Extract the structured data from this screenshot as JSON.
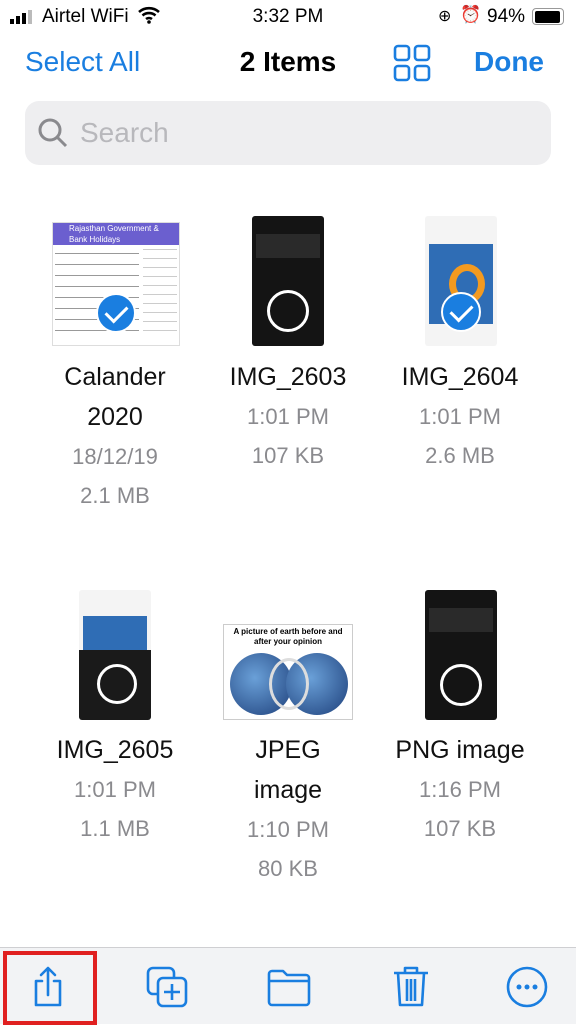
{
  "status": {
    "carrier": "Airtel WiFi",
    "time": "3:32 PM",
    "battery": "94%"
  },
  "nav": {
    "select_all": "Select All",
    "title": "2 Items",
    "done": "Done"
  },
  "search": {
    "placeholder": "Search"
  },
  "files": [
    {
      "name": "Calander 2020",
      "line1": "18/12/19",
      "line2": "2.1 MB",
      "selected": true,
      "thumb_text": "Rajasthan Government & Bank Holidays"
    },
    {
      "name": "IMG_2603",
      "line1": "1:01 PM",
      "line2": "107 KB",
      "selected": false
    },
    {
      "name": "IMG_2604",
      "line1": "1:01 PM",
      "line2": "2.6 MB",
      "selected": true
    },
    {
      "name": "IMG_2605",
      "line1": "1:01 PM",
      "line2": "1.1 MB",
      "selected": false
    },
    {
      "name": "JPEG image",
      "line1": "1:10 PM",
      "line2": "80 KB",
      "selected": false,
      "thumb_text": "A picture of earth before and after your opinion"
    },
    {
      "name": "PNG image",
      "line1": "1:16 PM",
      "line2": "107 KB",
      "selected": false
    }
  ],
  "toolbar": {
    "items": [
      "share-icon",
      "duplicate-icon",
      "folder-icon",
      "trash-icon",
      "more-icon"
    ],
    "highlight": "#e02020"
  },
  "colors": {
    "accent": "#1a7ee0"
  }
}
